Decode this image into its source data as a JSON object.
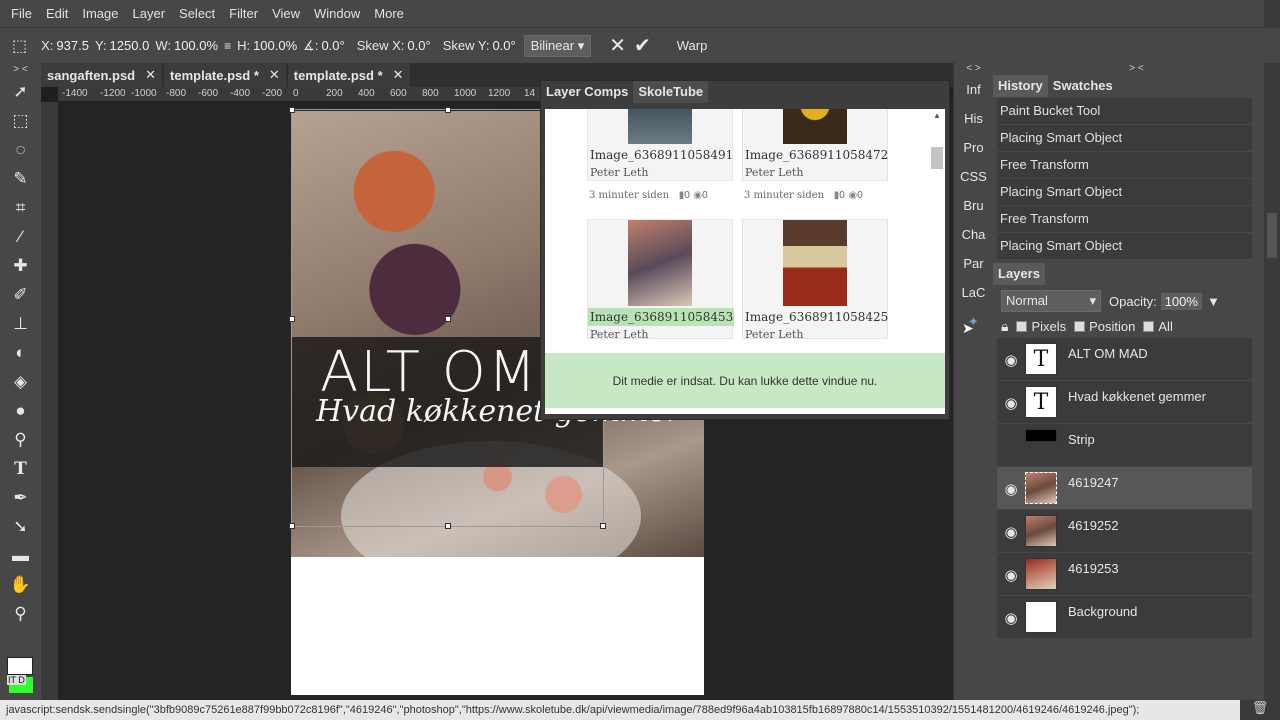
{
  "menubar": {
    "items": [
      "File",
      "Edit",
      "Image",
      "Layer",
      "Select",
      "Filter",
      "View",
      "Window",
      "More"
    ]
  },
  "optbar": {
    "x_label": "X:",
    "x_val": "937.5",
    "y_label": "Y:",
    "y_val": "1250.0",
    "w_label": "W:",
    "w_val": "100.0%",
    "h_label": "H:",
    "h_val": "100.0%",
    "rot_label": "∡:",
    "rot_val": "0.0°",
    "skewx_label": "Skew X:",
    "skewx_val": "0.0°",
    "skewy_label": "Skew Y:",
    "skewy_val": "0.0°",
    "interp": "Bilinear",
    "warp": "Warp"
  },
  "tools": {
    "toggle": "> <",
    "bottom_labels": "IT D"
  },
  "doc_tabs": [
    "sangaften.psd",
    "template.psd *",
    "template.psd *"
  ],
  "ruler": [
    "-1400",
    "-1200",
    "-1000",
    "-800",
    "-600",
    "-400",
    "-200",
    "0",
    "200",
    "400",
    "600",
    "800",
    "1000",
    "1200",
    "14"
  ],
  "canvas": {
    "title1": "ALT OM",
    "title2": "Hvad køkkenet gemmer"
  },
  "float_panel": {
    "tabs": [
      "Layer Comps",
      "SkoleTube"
    ],
    "cards": [
      {
        "name": "Image_6368911058491...",
        "author": "Peter Leth",
        "time": "3 minuter siden",
        "comments": "0",
        "views": "0"
      },
      {
        "name": "Image_6368911058472...",
        "author": "Peter Leth",
        "time": "3 minuter siden",
        "comments": "0",
        "views": "0"
      },
      {
        "name": "Image_6368911058453...",
        "author": "Peter Leth",
        "time": "",
        "comments": "",
        "views": ""
      },
      {
        "name": "Image_6368911058425...",
        "author": "Peter Leth",
        "time": "",
        "comments": "",
        "views": ""
      }
    ],
    "notice": "Dit medie er indsat. Du kan lukke dette vindue nu."
  },
  "dock": {
    "toggle": "< >",
    "items": [
      "Inf",
      "His",
      "Pro",
      "CSS",
      "Bru",
      "Cha",
      "Par",
      "LaC"
    ]
  },
  "right": {
    "toggle": "> <",
    "history_tabs": [
      "History",
      "Swatches"
    ],
    "history": [
      "Paint Bucket Tool",
      "Placing Smart Object",
      "Free Transform",
      "Placing Smart Object",
      "Free Transform",
      "Placing Smart Object"
    ],
    "layers_tab": "Layers",
    "blend": "Normal",
    "opacity_label": "Opacity:",
    "opacity_val": "100%",
    "lock_labels": [
      "Pixels",
      "Position",
      "All"
    ],
    "layers": [
      {
        "name": "ALT OM MAD",
        "type": "text"
      },
      {
        "name": "Hvad køkkenet gemmer",
        "type": "text"
      },
      {
        "name": "Strip",
        "type": "strip"
      },
      {
        "name": "4619247",
        "type": "photo",
        "selected": true
      },
      {
        "name": "4619252",
        "type": "photo"
      },
      {
        "name": "4619253",
        "type": "photo"
      },
      {
        "name": "Background",
        "type": "white"
      }
    ]
  },
  "statusbar": "javascript:sendsk.sendsingle(\"3bfb9089c75261e887f99bb072c8196f\",\"4619246\",\"photoshop\",\"https://www.skoletube.dk/api/viewmedia/image/788ed9f96a4ab103815fb16897880c14/1553510392/1551481200/4619246/4619246.jpeg\");"
}
